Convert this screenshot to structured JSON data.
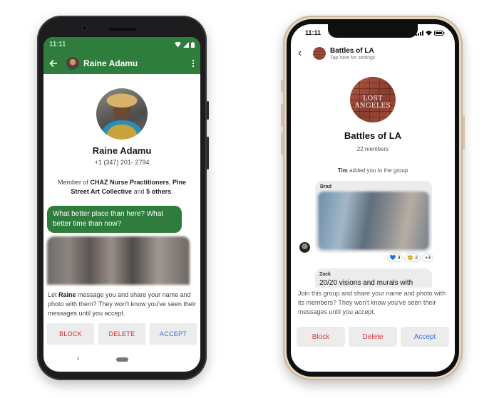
{
  "android": {
    "status_time": "11:11",
    "contact_name": "Raine Adamu",
    "phone": "+1 (347) 201- 2794",
    "membership": {
      "prefix": "Member of ",
      "group1": "CHAZ Nurse Practitioners",
      "sep": ", ",
      "group2": "Pine Street Art Collective",
      "mid": " and ",
      "others": "5 others",
      "suffix": "."
    },
    "message": "What better place than here? What better time than now?",
    "prompt": {
      "prefix": "Let ",
      "name": "Raine",
      "suffix": " message you and share your name and photo with them? They won't know you've seen their messages until you accept."
    },
    "buttons": {
      "block": "BLOCK",
      "delete": "DELETE",
      "accept": "ACCEPT"
    },
    "nav_back": "‹"
  },
  "iphone": {
    "status_time": "11:11",
    "back_glyph": "‹",
    "group_name": "Battles of LA",
    "group_subtitle": "Tap here for settings",
    "avatar_text": "LOST ANGELES",
    "members": "22 members",
    "event": {
      "actor": "Tim",
      "text": " added you to the group"
    },
    "message1": {
      "sender": "Brad",
      "reactions": [
        {
          "emoji": "💙",
          "count": "3"
        },
        {
          "emoji": "😊",
          "count": "2"
        },
        {
          "emoji": "",
          "count": "+3"
        }
      ]
    },
    "message2": {
      "sender": "Zack",
      "body": "20/20 visions and murals with"
    },
    "prompt": "Join this group and share your name and photo with its members? They won't know you've seen their messages until you accept.",
    "buttons": {
      "block": "Block",
      "delete": "Delete",
      "accept": "Accept"
    }
  },
  "colors": {
    "signal_green": "#2e7d3c",
    "accept_blue": "#3b6fd1",
    "block_red": "#d32f2f"
  }
}
